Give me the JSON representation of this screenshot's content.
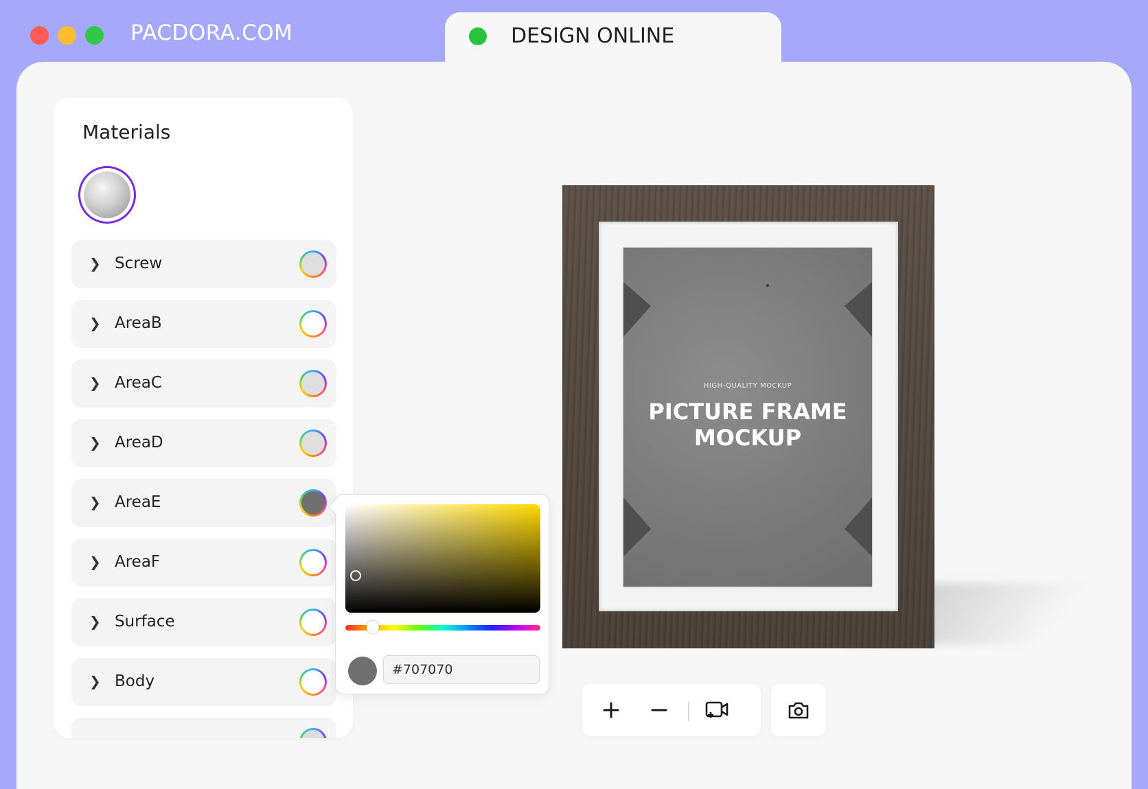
{
  "window_controls": [
    {
      "name": "close-dot",
      "color": "#fc5b57"
    },
    {
      "name": "minimize-dot",
      "color": "#fdbc2e"
    },
    {
      "name": "maximize-dot",
      "color": "#33c748"
    }
  ],
  "brand": {
    "label": "PACDORA.COM"
  },
  "tab": {
    "label": "DESIGN ONLINE",
    "dot_color": "#28c23c"
  },
  "materials": {
    "title": "Materials",
    "accent_color": "#7a2ae0",
    "parts": [
      {
        "label": "Screw",
        "color": "#dedede"
      },
      {
        "label": "AreaB",
        "color": "#ffffff"
      },
      {
        "label": "AreaC",
        "color": "#dedede"
      },
      {
        "label": "AreaD",
        "color": "#dedede"
      },
      {
        "label": "AreaE",
        "color": "#707070"
      },
      {
        "label": "AreaF",
        "color": "#ffffff"
      },
      {
        "label": "Surface",
        "color": "#ffffff"
      },
      {
        "label": "Body",
        "color": "#ffffff"
      },
      {
        "label": "",
        "color": "#dedede"
      }
    ]
  },
  "color_picker": {
    "hex_value": "#707070",
    "current_color": "#707070",
    "hue_color": "#ffd800",
    "hue_position": 0.14
  },
  "preview": {
    "poster_subtitle": "HIGH-QUALITY MOCKUP",
    "poster_title_line1": "PICTURE FRAME",
    "poster_title_line2": "MOCKUP"
  },
  "toolbar": {
    "icons": [
      "plus-icon",
      "minus-icon",
      "add-camera-view-icon",
      "camera-icon"
    ]
  }
}
